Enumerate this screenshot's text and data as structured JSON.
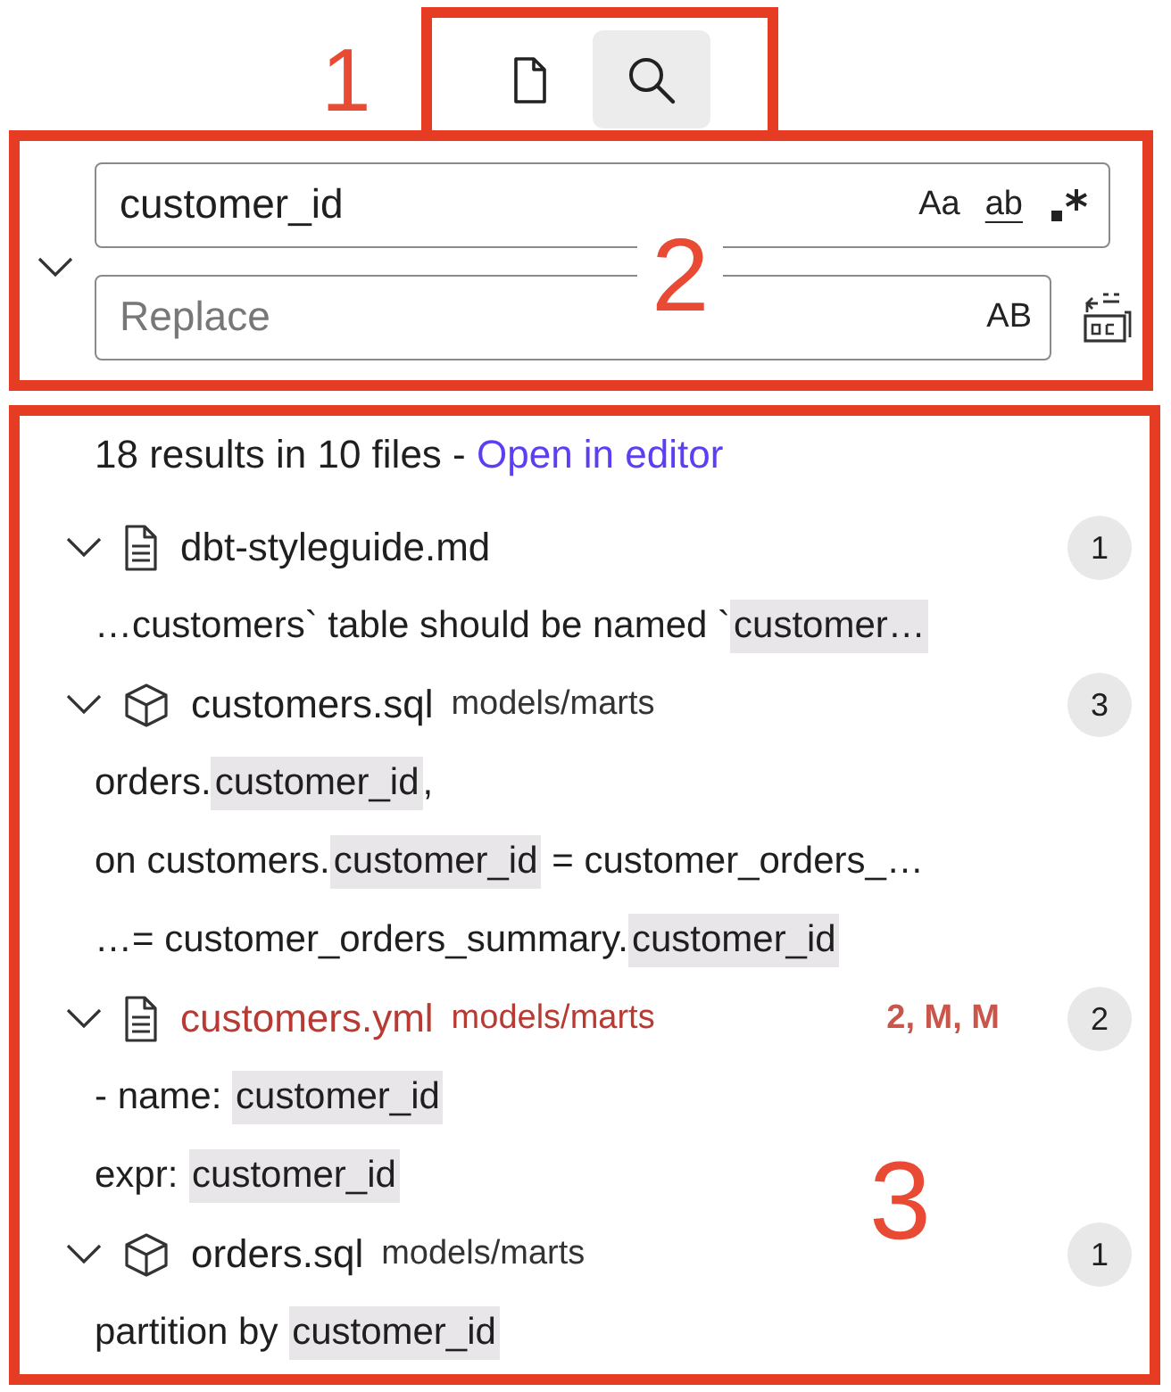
{
  "annotations": [
    "1",
    "2",
    "3"
  ],
  "tabs": [
    {
      "kind": "file",
      "selected": false
    },
    {
      "kind": "search",
      "selected": true
    }
  ],
  "search": {
    "expanded": true,
    "value": "customer_id",
    "options": [
      "Aa",
      "ab"
    ],
    "replace_placeholder": "Replace",
    "preserve_case": "AB"
  },
  "summary": {
    "text": "18 results in 10 files - ",
    "link": "Open in editor"
  },
  "files": [
    {
      "name": "dbt-styleguide.md",
      "kind": "document",
      "modified": false,
      "count": "1",
      "expanded": true,
      "matches": [
        {
          "before": "…customers` table should be named `",
          "match": "customer…"
        }
      ]
    },
    {
      "name": "customers.sql",
      "kind": "model",
      "path": "models/marts",
      "modified": false,
      "count": "3",
      "expanded": true,
      "matches": [
        {
          "before": "orders.",
          "match": "customer_id",
          "after": ","
        },
        {
          "before": "on customers.",
          "match": "customer_id",
          "after": " = customer_orders_…"
        },
        {
          "before": "…= customer_orders_summary.",
          "match": "customer_id"
        }
      ]
    },
    {
      "name": "customers.yml",
      "kind": "document",
      "path": "models/marts",
      "modified": true,
      "status": "2, M, M",
      "count": "2",
      "expanded": true,
      "matches": [
        {
          "before": "- name: ",
          "match": "customer_id"
        },
        {
          "before": "expr: ",
          "match": "customer_id"
        }
      ]
    },
    {
      "name": "orders.sql",
      "kind": "model",
      "path": "models/marts",
      "modified": false,
      "count": "1",
      "expanded": true,
      "matches": [
        {
          "before": "partition by ",
          "match": "customer_id"
        }
      ]
    }
  ]
}
